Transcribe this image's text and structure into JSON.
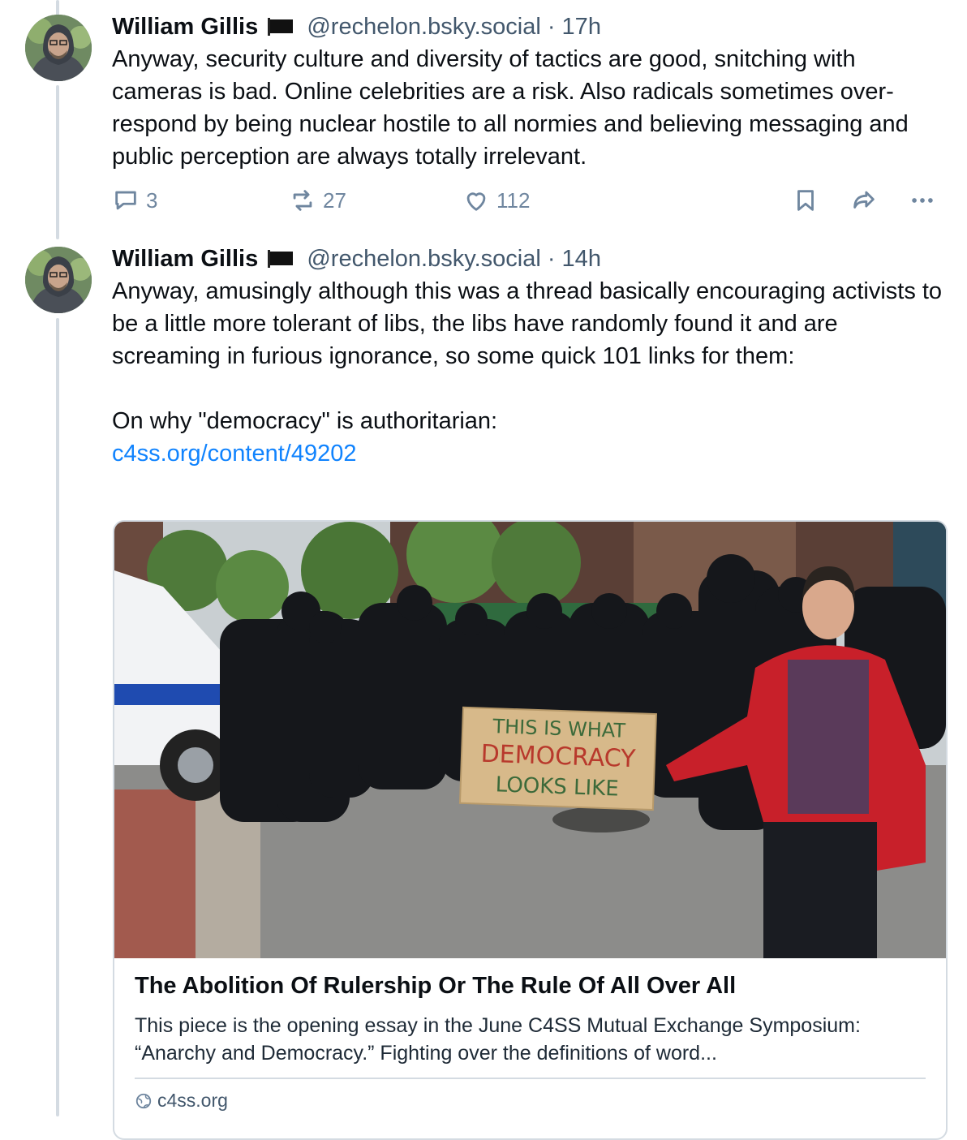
{
  "posts": [
    {
      "author": "William Gillis",
      "handle": "@rechelon.bsky.social",
      "time": "· 17h",
      "text": "Anyway, security culture and diversity of tactics are good, snitching with cameras is bad. Online celebrities are a risk. Also radicals sometimes over-respond by being nuclear hostile to all normies and believing messaging and public perception are always totally irrelevant.",
      "replies": "3",
      "reposts": "27",
      "likes": "112"
    },
    {
      "author": "William Gillis",
      "handle": "@rechelon.bsky.social",
      "time": "· 14h",
      "text": "Anyway, amusingly although this was a thread basically encouraging activists to be a little more tolerant of libs, the libs have randomly found it and are screaming in furious ignorance, so some quick 101 links for them:\n\nOn why \"democracy\" is authoritarian:",
      "link": "c4ss.org/content/49202",
      "card": {
        "sign_line1": "THIS IS WHAT",
        "sign_line2": "DEMOCRACY",
        "sign_line3": "LOOKS LIKE",
        "title": "The Abolition Of Rulership Or The Rule Of All Over All",
        "description": "This piece is the opening essay in the June C4SS Mutual Exchange Symposium: “Anarchy and Democracy.” Fighting over the definitions of word...",
        "domain": "c4ss.org"
      }
    }
  ],
  "colors": {
    "link": "#1083fe",
    "handle": "#42576c",
    "icon": "#6f869f",
    "thread_line": "#d4dbe2"
  },
  "icons": [
    "reply-icon",
    "repost-icon",
    "like-icon",
    "bookmark-icon",
    "share-icon",
    "more-icon",
    "globe-icon",
    "flag-icon"
  ]
}
